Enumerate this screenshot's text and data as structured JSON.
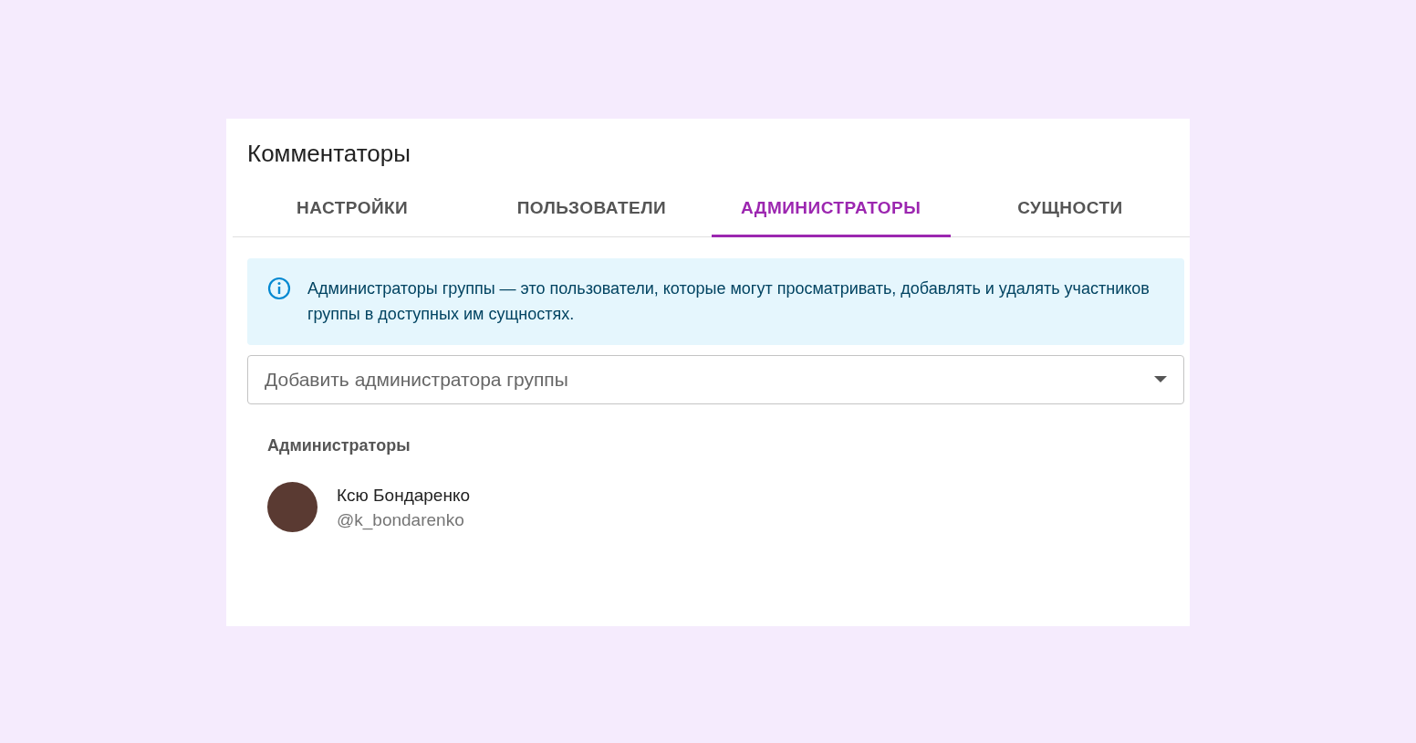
{
  "card": {
    "title": "Комментаторы"
  },
  "tabs": [
    {
      "label": "НАСТРОЙКИ",
      "selected": false
    },
    {
      "label": "ПОЛЬЗОВАТЕЛИ",
      "selected": false
    },
    {
      "label": "АДМИНИСТРАТОРЫ",
      "selected": true
    },
    {
      "label": "СУЩНОСТИ",
      "selected": false
    }
  ],
  "info_alert": {
    "text": "Администраторы группы — это пользователи, которые могут просматривать, добавлять и удалять участников группы в доступных им сущностях."
  },
  "add_admin_select": {
    "placeholder": "Добавить администратора группы"
  },
  "admins_section": {
    "heading": "Администраторы",
    "users": [
      {
        "name": "Ксю Бондаренко",
        "handle": "@k_bondarenko"
      }
    ]
  }
}
